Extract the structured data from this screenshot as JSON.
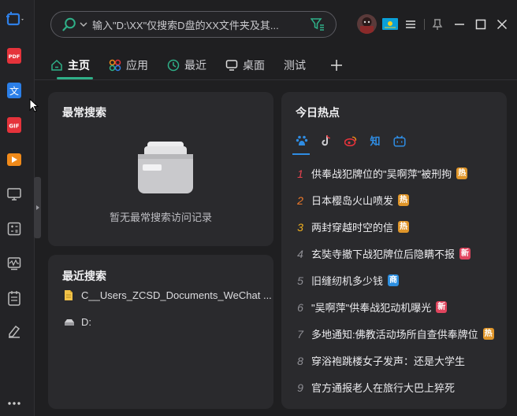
{
  "search": {
    "placeholder": "输入\"D:\\XX\"仅搜索D盘的XX文件夹及其..."
  },
  "tabs": [
    {
      "label": "主页",
      "icon": "home-icon",
      "active": true
    },
    {
      "label": "应用",
      "icon": "apps-icon",
      "active": false
    },
    {
      "label": "最近",
      "icon": "clock-icon",
      "active": false
    },
    {
      "label": "桌面",
      "icon": "monitor-icon",
      "active": false
    },
    {
      "label": "测试",
      "icon": "",
      "active": false
    }
  ],
  "frequent": {
    "title": "最常搜索",
    "empty_text": "暂无最常搜索访问记录"
  },
  "recent": {
    "title": "最近搜索",
    "items": [
      {
        "label": "C__Users_ZCSD_Documents_WeChat ...",
        "icon": "file-icon"
      },
      {
        "label": "D:",
        "icon": "drive-icon"
      }
    ]
  },
  "hot": {
    "title": "今日热点",
    "sources": [
      "baidu-icon",
      "douyin-icon",
      "weibo-icon",
      "zhihu-icon",
      "bilibili-icon"
    ],
    "items": [
      {
        "rank": "1",
        "text": "供奉战犯牌位的\"吴啊萍\"被刑拘",
        "badge": "热",
        "badge_color": "#e0962a",
        "rank_color": "#e8424f"
      },
      {
        "rank": "2",
        "text": "日本樱岛火山喷发",
        "badge": "热",
        "badge_color": "#e0962a",
        "rank_color": "#f07a2a"
      },
      {
        "rank": "3",
        "text": "两封穿越时空的信",
        "badge": "热",
        "badge_color": "#e0962a",
        "rank_color": "#f2b11f"
      },
      {
        "rank": "4",
        "text": "玄奘寺撤下战犯牌位后隐瞒不报",
        "badge": "新",
        "badge_color": "#e0455e",
        "rank_color": "#8f8f95"
      },
      {
        "rank": "5",
        "text": "旧缝纫机多少钱",
        "badge": "商",
        "badge_color": "#2d8fe0",
        "rank_color": "#8f8f95"
      },
      {
        "rank": "6",
        "text": "\"吴啊萍\"供奉战犯动机曝光",
        "badge": "新",
        "badge_color": "#e0455e",
        "rank_color": "#8f8f95"
      },
      {
        "rank": "7",
        "text": "多地通知:佛教活动场所自查供奉牌位",
        "badge": "热",
        "badge_color": "#e0962a",
        "rank_color": "#8f8f95"
      },
      {
        "rank": "8",
        "text": "穿浴袍跳楼女子发声：还是大学生",
        "badge": "",
        "badge_color": "",
        "rank_color": "#8f8f95"
      },
      {
        "rank": "9",
        "text": "官方通报老人在旅行大巴上猝死",
        "badge": "",
        "badge_color": "",
        "rank_color": "#8f8f95"
      }
    ]
  }
}
